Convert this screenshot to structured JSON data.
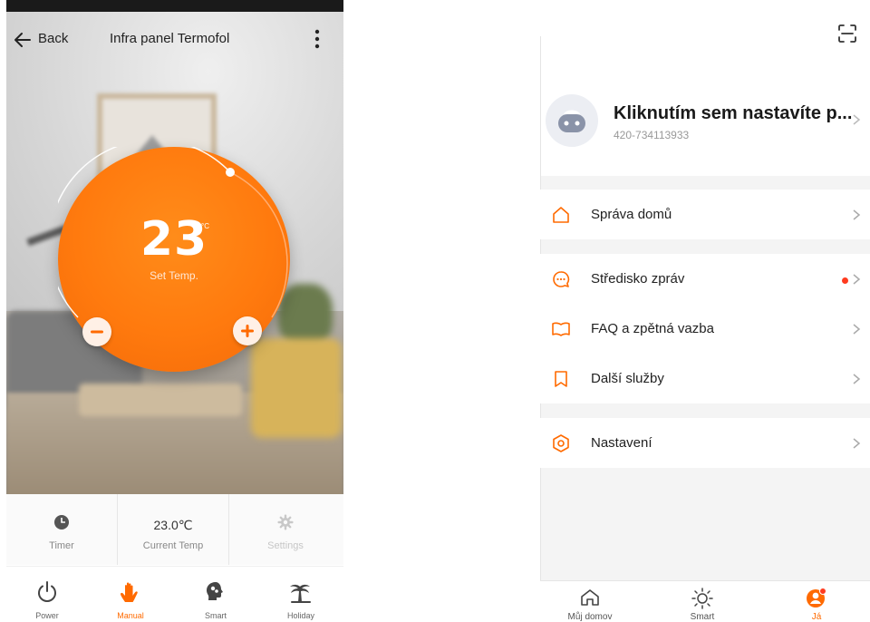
{
  "thermostat": {
    "header": {
      "back_label": "Back",
      "title": "Infra panel Termofol"
    },
    "dial": {
      "temperature": "23",
      "unit": "°C",
      "label": "Set Temp."
    },
    "stats": [
      {
        "icon": "clock-icon",
        "value": "",
        "caption": "Timer"
      },
      {
        "icon": "",
        "value": "23.0℃",
        "caption": "Current Temp"
      },
      {
        "icon": "gear-icon",
        "value": "",
        "caption": "Settings"
      }
    ],
    "nav": [
      {
        "label": "Power",
        "icon": "power-icon",
        "active": false
      },
      {
        "label": "Manual",
        "icon": "hand-icon",
        "active": true
      },
      {
        "label": "Smart",
        "icon": "brain-head-icon",
        "active": false
      },
      {
        "label": "Holiday",
        "icon": "palm-tree-icon",
        "active": false
      }
    ],
    "accent_color": "#ff6a00"
  },
  "profile": {
    "name": "Kliknutím sem nastavíte p...",
    "phone": "420-734113933",
    "menu": [
      {
        "label": "Správa domů",
        "icon": "home-icon"
      },
      {
        "label": "Středisko zpráv",
        "icon": "chat-bubble-icon",
        "badge": true
      },
      {
        "label": "FAQ a zpětná vazba",
        "icon": "book-icon"
      },
      {
        "label": "Další služby",
        "icon": "bookmark-icon"
      },
      {
        "label": "Nastavení",
        "icon": "settings-hex-icon"
      }
    ],
    "nav": [
      {
        "label": "Můj domov",
        "icon": "home-outline-icon",
        "active": false
      },
      {
        "label": "Smart",
        "icon": "sun-icon",
        "active": false
      },
      {
        "label": "Já",
        "icon": "person-icon",
        "active": true
      }
    ],
    "accent_color": "#ff6a00"
  }
}
